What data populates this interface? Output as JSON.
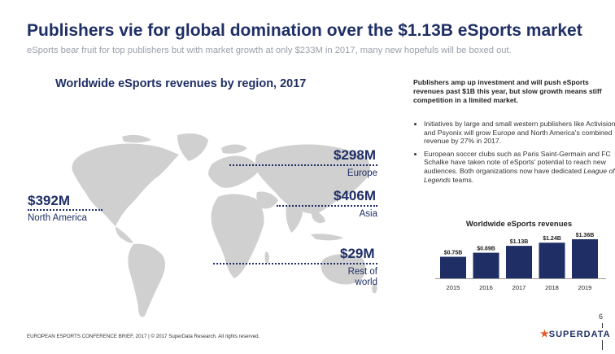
{
  "header": {
    "title": "Publishers vie for global domination over the $1.13B eSports market",
    "subtitle": "eSports bear fruit for top publishers but with market growth at only $233M in 2017, many new hopefuls will be boxed out."
  },
  "map": {
    "title": "Worldwide eSports revenues by region, 2017",
    "regions": [
      {
        "value": "$392M",
        "name": "North America"
      },
      {
        "value": "$298M",
        "name": "Europe"
      },
      {
        "value": "$406M",
        "name": "Asia"
      },
      {
        "value": "$29M",
        "name": "Rest of world"
      }
    ]
  },
  "sidebar": {
    "lead": "Publishers amp up investment and will push eSports revenues past $1B this year, but slow growth means stiff competition in a limited market.",
    "bullet1": "Initiatives by large and small western publishers like Activision and Psyonix will grow Europe and North America's combined revenue by 27% in 2017.",
    "bullet2_a": "European soccer clubs such as Paris Saint-Germain and FC Schalke have taken note of eSports' potential to reach new audiences. Both organizations now have dedicated ",
    "bullet2_em": "League of Legends",
    "bullet2_b": " teams."
  },
  "chart_data": {
    "type": "bar",
    "title": "Worldwide eSports revenues",
    "categories": [
      "2015",
      "2016",
      "2017",
      "2018",
      "2019"
    ],
    "values": [
      0.75,
      0.89,
      1.13,
      1.24,
      1.36
    ],
    "labels": [
      "$0.75B",
      "$0.89B",
      "$1.13B",
      "$1.24B",
      "$1.36B"
    ],
    "ylim": [
      0,
      1.36
    ],
    "color": "#1f2f66"
  },
  "footer": {
    "text": "EUROPEAN ESPORTS CONFERENCE BRIEF, 2017  |  © 2017 SuperData Research. All rights reserved.",
    "page": "6",
    "logo": "SUPERDATA"
  }
}
